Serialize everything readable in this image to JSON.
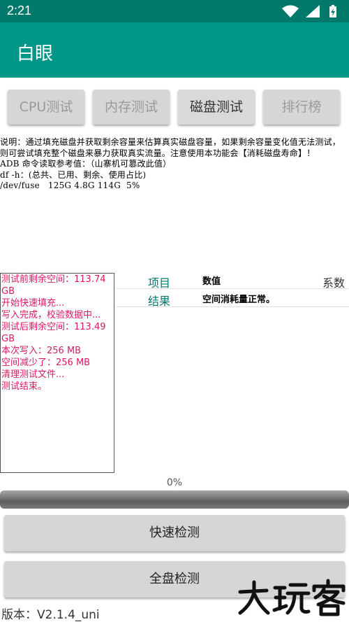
{
  "status_bar": {
    "time": "2:21",
    "icons": [
      "wifi-icon",
      "signal-icon",
      "battery-icon"
    ]
  },
  "app_bar": {
    "title": "白眼"
  },
  "tabs": [
    {
      "label": "CPU测试",
      "active": false
    },
    {
      "label": "内存测试",
      "active": false
    },
    {
      "label": "磁盘测试",
      "active": true
    },
    {
      "label": "排行榜",
      "active": false
    }
  ],
  "description": "说明：通过填充磁盘并获取剩余容量来估算真实磁盘容量，如果剩余容量变化值无法测试，则可尝试填充整个磁盘来暴力获取真实流量。注意使用本功能会【消耗磁盘寿命】！\nADB 命令读取参考值：（山寨机可篡改此值）\ndf -h：(总共、已用、剩余、使用占比)\n/dev/fuse   125G 4.8G 114G  5%",
  "log_lines": [
    "测试前剩余空间：113.74 GB",
    "开始快速填充...",
    "写入完成，校验数据中...",
    "测试后剩余空间：113.49 GB",
    "本次写入：256 MB",
    "空间减少了：256 MB",
    "清理测试文件...",
    "测试结束。"
  ],
  "result_table": {
    "headers": [
      "项目",
      "数值",
      "系数"
    ],
    "rows": [
      [
        "结果",
        "空间消耗量正常。",
        ""
      ]
    ]
  },
  "progress": {
    "label": "0%",
    "value": 0
  },
  "buttons": {
    "quick": "快速检测",
    "full": "全盘检测"
  },
  "version": "版本：V2.1.4_uni",
  "watermark": "大玩客",
  "colors": {
    "status_bar": "#00796b",
    "app_bar": "#009688",
    "log_text": "#d81b60",
    "table_key": "#00796b"
  }
}
